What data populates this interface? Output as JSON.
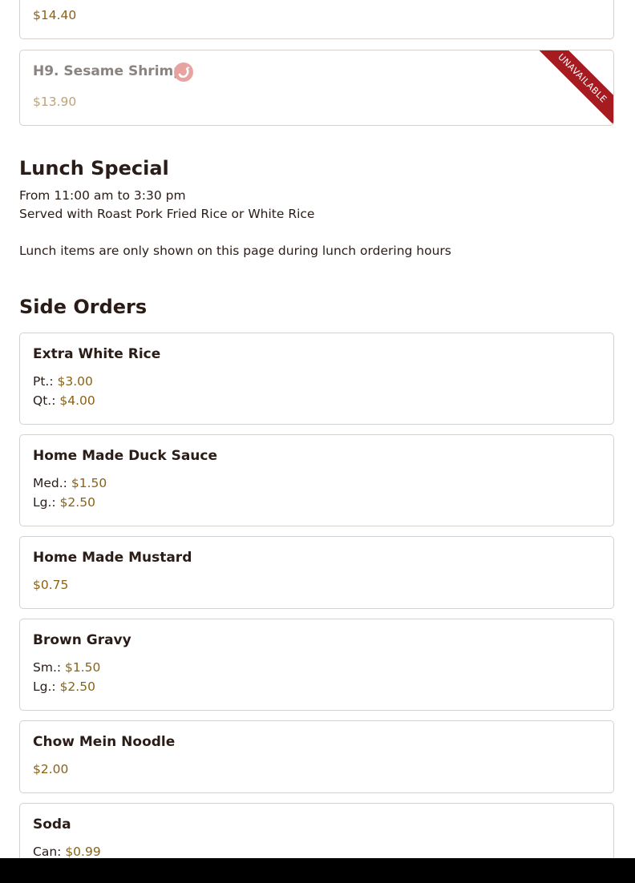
{
  "previous_item": {
    "price": "$14.40"
  },
  "h9": {
    "name": "H9. Sesame Shrimp",
    "price": "$13.90",
    "badge": "UNAVAILABLE",
    "spicy_icon": "spicy-pepper-icon"
  },
  "lunch_special": {
    "heading": "Lunch Special",
    "hours": "From 11:00 am to 3:30 pm",
    "served_with": "Served with Roast Pork Fried Rice or White Rice",
    "note": "Lunch items are only shown on this page during lunch ordering hours"
  },
  "side_orders": {
    "heading": "Side Orders",
    "items": [
      {
        "name": "Extra White Rice",
        "prices": [
          {
            "size": "Pt.:",
            "price": "$3.00"
          },
          {
            "size": "Qt.:",
            "price": "$4.00"
          }
        ]
      },
      {
        "name": "Home Made Duck Sauce",
        "prices": [
          {
            "size": "Med.:",
            "price": "$1.50"
          },
          {
            "size": "Lg.:",
            "price": "$2.50"
          }
        ]
      },
      {
        "name": "Home Made Mustard",
        "prices": [
          {
            "size": "",
            "price": "$0.75"
          }
        ]
      },
      {
        "name": "Brown Gravy",
        "prices": [
          {
            "size": "Sm.:",
            "price": "$1.50"
          },
          {
            "size": "Lg.:",
            "price": "$2.50"
          }
        ]
      },
      {
        "name": "Chow Mein Noodle",
        "prices": [
          {
            "size": "",
            "price": "$2.00"
          }
        ]
      },
      {
        "name": "Soda",
        "prices": [
          {
            "size": "Can:",
            "price": "$0.99"
          }
        ]
      }
    ]
  },
  "colors": {
    "price": "#8b6214",
    "unavailable_ribbon": "#a51b1f",
    "card_border": "#d6d1cc"
  }
}
